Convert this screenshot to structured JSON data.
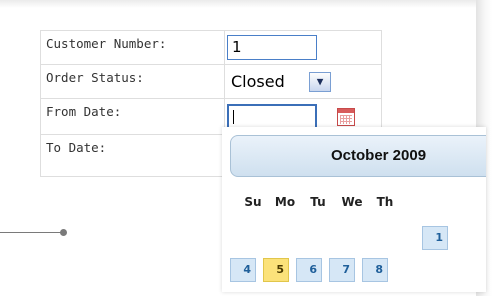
{
  "form": {
    "customer_number_label": "Customer Number:",
    "customer_number_value": "1",
    "order_status_label": "Order Status:",
    "order_status_value": "Closed",
    "from_date_label": "From Date:",
    "from_date_value": "",
    "to_date_label": "To Date:"
  },
  "calendar": {
    "month_title": "October 2009",
    "weekdays": [
      "Su",
      "Mo",
      "Tu",
      "We",
      "Th"
    ],
    "row1": [
      "1"
    ],
    "row2": [
      "4",
      "5",
      "6",
      "7",
      "8"
    ],
    "today": "5"
  },
  "colors": {
    "input_border": "#4a7fc8",
    "calendar_header": "#cfe0ef",
    "day_cell": "#d6e7f6",
    "day_text": "#1f5f9a",
    "today_highlight": "#fbe27a"
  },
  "icons": {
    "select_arrow": "chevron-down-icon",
    "date_picker": "calendar-icon"
  }
}
